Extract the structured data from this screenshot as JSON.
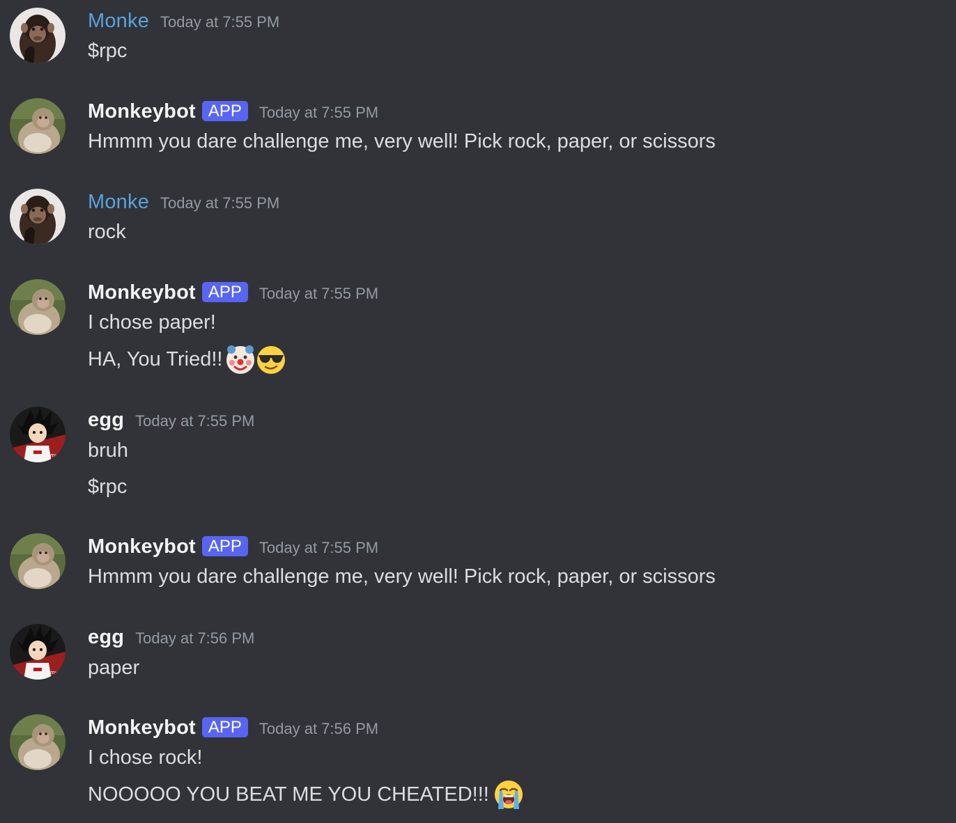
{
  "messages": [
    {
      "username": "Monke",
      "timestamp": "Today at 7:55 PM",
      "lines": [
        "$rpc"
      ],
      "avatar": "chimp-avatar"
    },
    {
      "username": "Monkeybot",
      "tag": "APP",
      "timestamp": "Today at 7:55 PM",
      "lines": [
        "Hmmm you dare challenge me, very well! Pick rock, paper, or scissors"
      ],
      "avatar": "macaque-avatar"
    },
    {
      "username": "Monke",
      "timestamp": "Today at 7:55 PM",
      "lines": [
        "rock"
      ],
      "avatar": "chimp-avatar"
    },
    {
      "username": "Monkeybot",
      "tag": "APP",
      "timestamp": "Today at 7:55 PM",
      "lines": [
        "I chose paper!",
        "HA, You Tried!!"
      ],
      "emojis": [
        "clown-face-emoji",
        "sunglasses-face-emoji"
      ],
      "avatar": "macaque-avatar"
    },
    {
      "username": "egg",
      "timestamp": "Today at 7:55 PM",
      "lines": [
        "bruh",
        "$rpc"
      ],
      "avatar": "anime-avatar"
    },
    {
      "username": "Monkeybot",
      "tag": "APP",
      "timestamp": "Today at 7:55 PM",
      "lines": [
        "Hmmm you dare challenge me, very well! Pick rock, paper, or scissors"
      ],
      "avatar": "macaque-avatar"
    },
    {
      "username": "egg",
      "timestamp": "Today at 7:56 PM",
      "lines": [
        "paper"
      ],
      "avatar": "anime-avatar"
    },
    {
      "username": "Monkeybot",
      "tag": "APP",
      "timestamp": "Today at 7:56 PM",
      "lines": [
        "I chose rock!",
        "NOOOOO YOU BEAT ME YOU CHEATED!!!"
      ],
      "emojis": [
        "loudly-crying-face-emoji"
      ],
      "avatar": "macaque-avatar"
    }
  ],
  "colors": {
    "background": "#313338",
    "username_monke": "#5aa2dc",
    "username_default": "#f2f3f5",
    "app_tag": "#5865f2",
    "timestamp": "#949ba4",
    "message_text": "#dbdee1"
  }
}
